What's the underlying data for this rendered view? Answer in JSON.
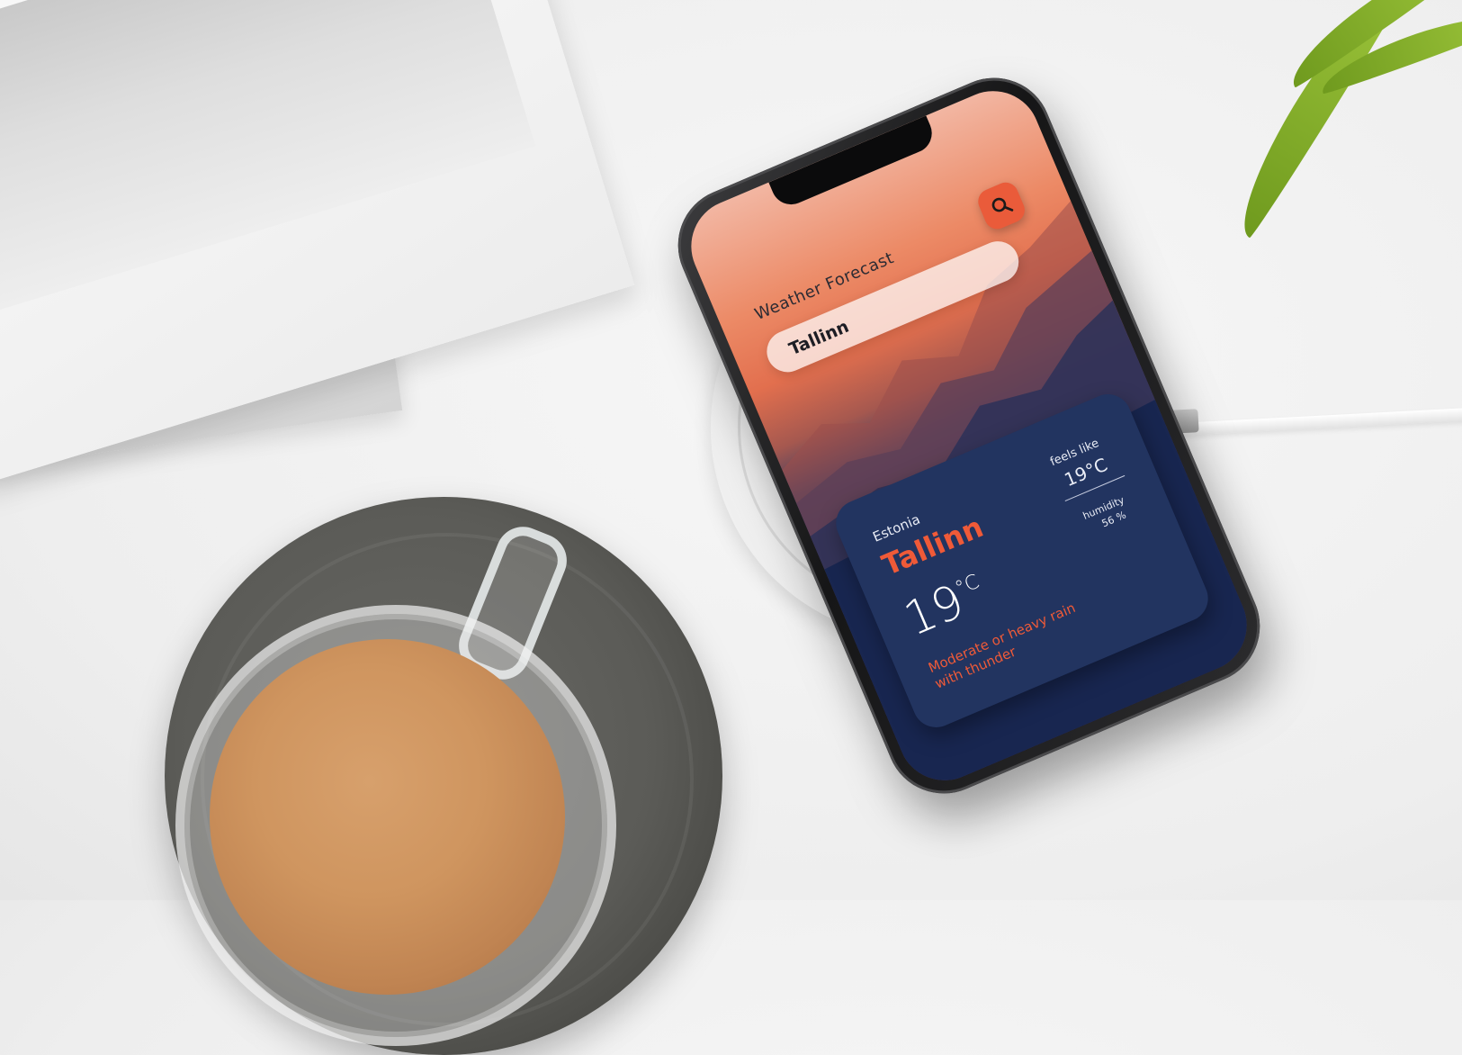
{
  "app": {
    "title": "Weather Forecast",
    "search_value": "Tallinn"
  },
  "icons": {
    "search": "search-icon"
  },
  "weather": {
    "country": "Estonia",
    "city": "Tallinn",
    "temp_value": "19",
    "temp_unit": "°C",
    "description": "Moderate or heavy rain with thunder",
    "feels_like_label": "feels like",
    "feels_like_value": "19°C",
    "humidity_label": "humidity",
    "humidity_value": "56 %"
  },
  "colors": {
    "accent": "#ef5a38",
    "card": "#223460",
    "screen_bottom": "#0f1a3b"
  }
}
